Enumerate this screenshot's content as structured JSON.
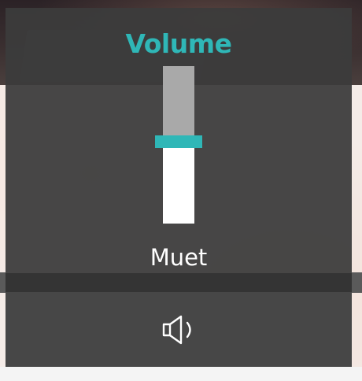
{
  "volume_panel": {
    "title": "Volume",
    "mute_label": "Muet",
    "level": 0.52,
    "colors": {
      "accent": "#2fb7b7",
      "panel": "#3c3c3c",
      "track_filled": "#ffffff",
      "track_empty": "#a9a9a9"
    },
    "speaker_button_icon": "speaker-icon"
  }
}
